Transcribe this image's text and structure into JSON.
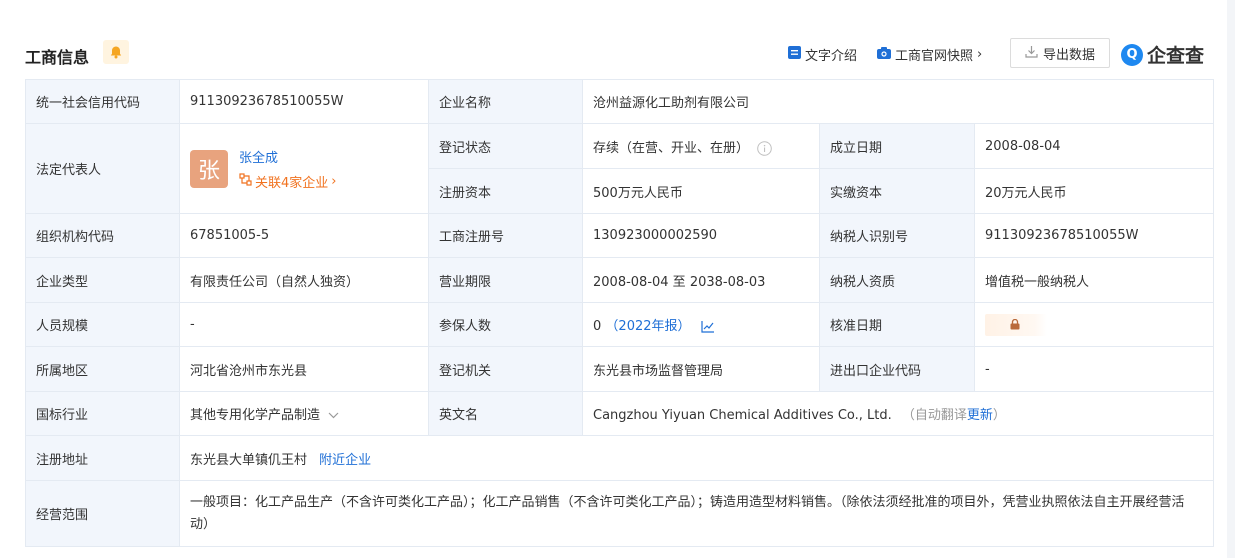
{
  "header": {
    "title": "工商信息",
    "text_intro": "文字介绍",
    "snapshot": "工商官网快照",
    "export": "导出数据",
    "logo": "企查查"
  },
  "rows": {
    "credit_code_label": "统一社会信用代码",
    "credit_code": "91130923678510055W",
    "company_name_label": "企业名称",
    "company_name": "沧州益源化工助剂有限公司",
    "legal_rep_label": "法定代表人",
    "legal_rep_avatar": "张",
    "legal_rep_name": "张全成",
    "legal_rep_related": "关联4家企业",
    "reg_status_label": "登记状态",
    "reg_status": "存续（在营、开业、在册）",
    "founded_label": "成立日期",
    "founded": "2008-08-04",
    "reg_capital_label": "注册资本",
    "reg_capital": "500万元人民币",
    "paid_capital_label": "实缴资本",
    "paid_capital": "20万元人民币",
    "org_code_label": "组织机构代码",
    "org_code": "67851005-5",
    "biz_reg_no_label": "工商注册号",
    "biz_reg_no": "130923000002590",
    "taxpayer_id_label": "纳税人识别号",
    "taxpayer_id": "91130923678510055W",
    "company_type_label": "企业类型",
    "company_type": "有限责任公司（自然人独资）",
    "biz_term_label": "营业期限",
    "biz_term": "2008-08-04 至 2038-08-03",
    "taxpayer_qual_label": "纳税人资质",
    "taxpayer_qual": "增值税一般纳税人",
    "staff_size_label": "人员规模",
    "staff_size": "-",
    "insured_label": "参保人数",
    "insured_count": "0",
    "insured_year": "（2022年报）",
    "approval_date_label": "核准日期",
    "region_label": "所属地区",
    "region": "河北省沧州市东光县",
    "authority_label": "登记机关",
    "authority": "东光县市场监督管理局",
    "import_export_label": "进出口企业代码",
    "import_export": "-",
    "industry_label": "国标行业",
    "industry": "其他专用化学产品制造",
    "english_name_label": "英文名",
    "english_name": "Cangzhou Yiyuan Chemical Additives Co., Ltd.",
    "auto_translate": "（自动翻译",
    "update": "更新",
    "paren_close": "）",
    "address_label": "注册地址",
    "address": "东光县大单镇仉王村",
    "nearby": "附近企业",
    "scope_label": "经营范围",
    "scope": "一般项目：化工产品生产（不含许可类化工产品）；化工产品销售（不含许可类化工产品）；铸造用造型材料销售。（除依法须经批准的项目外，凭营业执照依法自主开展经营活动）"
  },
  "colors": {
    "accent": "#1f6fd6",
    "label_bg": "#f2f6fc",
    "orange": "#f1721f",
    "avatar": "#e8a37e"
  }
}
